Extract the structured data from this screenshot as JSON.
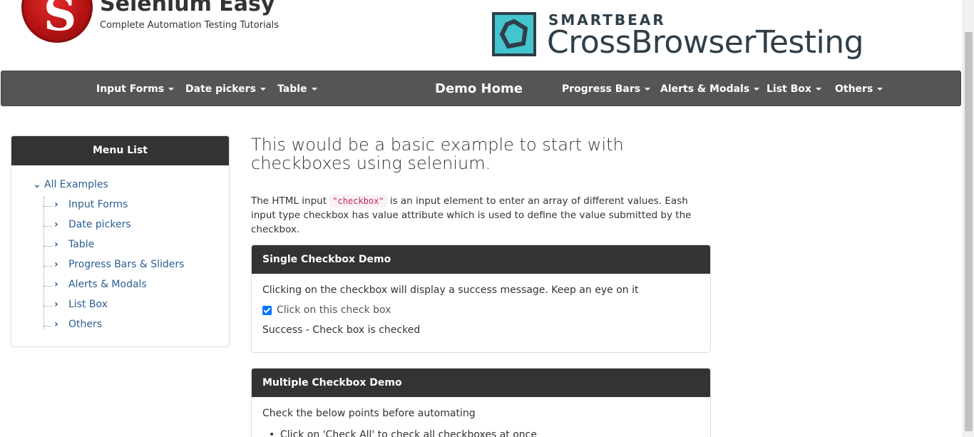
{
  "header": {
    "site_title": "Selenium Easy",
    "site_tagline": "Complete Automation Testing Tutorials",
    "sponsor_small": "SMARTBEAR",
    "sponsor_big": "CrossBrowserTesting"
  },
  "nav": {
    "input_forms": "Input Forms",
    "date_pickers": "Date pickers",
    "table": "Table",
    "demo_home": "Demo Home",
    "progress_bars": "Progress Bars",
    "alerts_modals": "Alerts & Modals",
    "list_box": "List Box",
    "others": "Others"
  },
  "sidebar": {
    "heading": "Menu List",
    "root": "All Examples",
    "items": [
      {
        "label": "Input Forms"
      },
      {
        "label": "Date pickers"
      },
      {
        "label": "Table"
      },
      {
        "label": "Progress Bars & Sliders"
      },
      {
        "label": "Alerts & Modals"
      },
      {
        "label": "List Box"
      },
      {
        "label": "Others"
      }
    ]
  },
  "main": {
    "title": "This would be a basic example to start with checkboxes using selenium.",
    "intro_before": "The HTML input ",
    "intro_code": "\"checkbox\"",
    "intro_after": " is an input element to enter an array of different values. Eash input type checkbox has value attribute which is used to define the value submitted by the checkbox."
  },
  "single_demo": {
    "heading": "Single Checkbox Demo",
    "description": "Clicking on the checkbox will display a success message. Keep an eye on it",
    "checkbox_label": "Click on this check box",
    "checked": true,
    "success_message": "Success - Check box is checked"
  },
  "multiple_demo": {
    "heading": "Multiple Checkbox Demo",
    "description": "Check the below points before automating",
    "bullet": "Click on 'Check All' to check all checkboxes at once"
  },
  "colors": {
    "navbar": "#555555",
    "panel_head": "#333333",
    "link": "#2b5e92",
    "checkbox": "#0075ff"
  }
}
